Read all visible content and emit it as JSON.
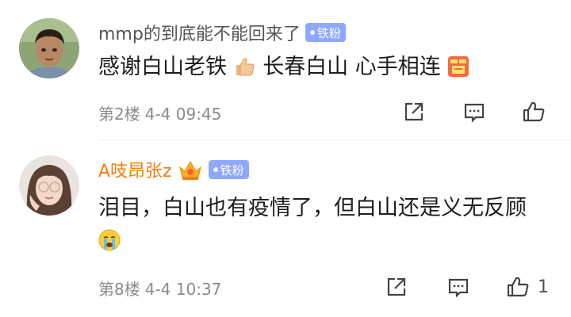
{
  "comments": [
    {
      "username": "mmp的到底能不能回来了",
      "badge": "铁粉",
      "text_parts": [
        "感谢白山老铁",
        " 长春白山 心手相连"
      ],
      "emojis": [
        "thumbs-up-emoji",
        "zan-emoji"
      ],
      "floor": "第2楼",
      "time": "4-4 09:45",
      "like_count": ""
    },
    {
      "username": "A吱昂张z",
      "badge": "铁粉",
      "text": "泪目，白山也有疫情了，但白山还是义无反顾",
      "emojis": [
        "crying-emoji"
      ],
      "floor": "第8楼",
      "time": "4-4 10:37",
      "like_count": "1"
    }
  ],
  "icons": {
    "share": "share-icon",
    "reply": "comment-icon",
    "like": "thumbs-up-icon",
    "vip": "crown-icon"
  },
  "colors": {
    "badge_bg": "#8fa8ff",
    "vip_name": "#f07e0f",
    "meta_text": "#8a8a8a",
    "main_text": "#1d1d1d"
  }
}
